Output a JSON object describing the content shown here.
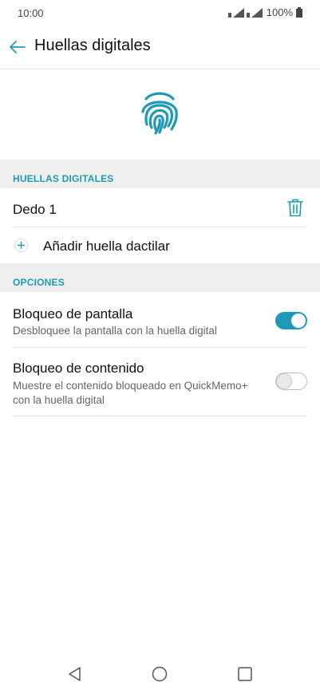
{
  "status_bar": {
    "time": "10:00",
    "battery": "100%"
  },
  "app_bar": {
    "title": "Huellas digitales"
  },
  "sections": {
    "fingerprints": {
      "header": "HUELLAS DIGITALES",
      "finger_label": "Dedo 1",
      "add_label": "Añadir huella dactilar"
    },
    "options": {
      "header": "OPCIONES",
      "items": [
        {
          "title": "Bloqueo de pantalla",
          "subtitle": "Desbloquee la pantalla con la huella digital",
          "enabled": true
        },
        {
          "title": "Bloqueo de contenido",
          "subtitle": "Muestre el contenido bloqueado en QuickMemo+ con la huella digital",
          "enabled": false
        }
      ]
    }
  },
  "colors": {
    "accent": "#1d9bb4",
    "section_bg": "#efefef"
  }
}
